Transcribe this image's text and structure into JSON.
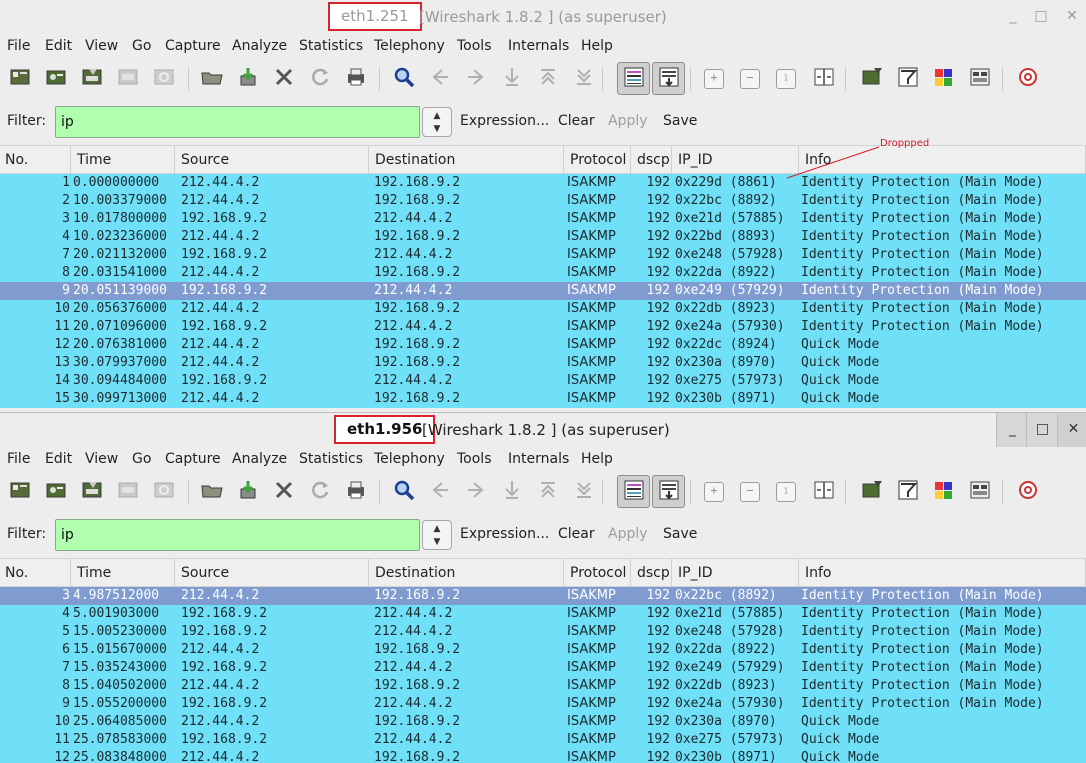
{
  "windows": [
    {
      "title": "eth1.251",
      "app_title": "[Wireshark 1.8.2 ] (as superuser)",
      "window_controls": {
        "minimize": "_",
        "maximize": "□",
        "close": "✕"
      },
      "filter": {
        "label": "Filter:",
        "value": "ip",
        "expression": "Expression...",
        "clear": "Clear",
        "apply": "Apply",
        "save": "Save"
      },
      "rows": [
        {
          "no": "1",
          "time": "0.000000000",
          "source": "212.44.4.2",
          "destination": "192.168.9.2",
          "protocol": "ISAKMP",
          "dscp": "192",
          "ip_id": "0x229d (8861)",
          "info": "Identity Protection (Main Mode)"
        },
        {
          "no": "2",
          "time": "10.003379000",
          "source": "212.44.4.2",
          "destination": "192.168.9.2",
          "protocol": "ISAKMP",
          "dscp": "192",
          "ip_id": "0x22bc (8892)",
          "info": "Identity Protection (Main Mode)"
        },
        {
          "no": "3",
          "time": "10.017800000",
          "source": "192.168.9.2",
          "destination": "212.44.4.2",
          "protocol": "ISAKMP",
          "dscp": "192",
          "ip_id": "0xe21d (57885)",
          "info": "Identity Protection (Main Mode)"
        },
        {
          "no": "4",
          "time": "10.023236000",
          "source": "212.44.4.2",
          "destination": "192.168.9.2",
          "protocol": "ISAKMP",
          "dscp": "192",
          "ip_id": "0x22bd (8893)",
          "info": "Identity Protection (Main Mode)"
        },
        {
          "no": "7",
          "time": "20.021132000",
          "source": "192.168.9.2",
          "destination": "212.44.4.2",
          "protocol": "ISAKMP",
          "dscp": "192",
          "ip_id": "0xe248 (57928)",
          "info": "Identity Protection (Main Mode)"
        },
        {
          "no": "8",
          "time": "20.031541000",
          "source": "212.44.4.2",
          "destination": "192.168.9.2",
          "protocol": "ISAKMP",
          "dscp": "192",
          "ip_id": "0x22da (8922)",
          "info": "Identity Protection (Main Mode)"
        },
        {
          "no": "9",
          "time": "20.051139000",
          "source": "192.168.9.2",
          "destination": "212.44.4.2",
          "protocol": "ISAKMP",
          "dscp": "192",
          "ip_id": "0xe249 (57929)",
          "info": "Identity Protection (Main Mode)",
          "selected": true
        },
        {
          "no": "10",
          "time": "20.056376000",
          "source": "212.44.4.2",
          "destination": "192.168.9.2",
          "protocol": "ISAKMP",
          "dscp": "192",
          "ip_id": "0x22db (8923)",
          "info": "Identity Protection (Main Mode)"
        },
        {
          "no": "11",
          "time": "20.071096000",
          "source": "192.168.9.2",
          "destination": "212.44.4.2",
          "protocol": "ISAKMP",
          "dscp": "192",
          "ip_id": "0xe24a (57930)",
          "info": "Identity Protection (Main Mode)"
        },
        {
          "no": "12",
          "time": "20.076381000",
          "source": "212.44.4.2",
          "destination": "192.168.9.2",
          "protocol": "ISAKMP",
          "dscp": "192",
          "ip_id": "0x22dc (8924)",
          "info": "Quick Mode"
        },
        {
          "no": "13",
          "time": "30.079937000",
          "source": "212.44.4.2",
          "destination": "192.168.9.2",
          "protocol": "ISAKMP",
          "dscp": "192",
          "ip_id": "0x230a (8970)",
          "info": "Quick Mode"
        },
        {
          "no": "14",
          "time": "30.094484000",
          "source": "192.168.9.2",
          "destination": "212.44.4.2",
          "protocol": "ISAKMP",
          "dscp": "192",
          "ip_id": "0xe275 (57973)",
          "info": "Quick Mode"
        },
        {
          "no": "15",
          "time": "30.099713000",
          "source": "212.44.4.2",
          "destination": "192.168.9.2",
          "protocol": "ISAKMP",
          "dscp": "192",
          "ip_id": "0x230b (8971)",
          "info": "Quick Mode"
        }
      ]
    },
    {
      "title": "eth1.956",
      "app_title": "[Wireshark 1.8.2 ] (as superuser)",
      "window_controls": {
        "minimize": "_",
        "maximize": "□",
        "close": "✕"
      },
      "filter": {
        "label": "Filter:",
        "value": "ip",
        "expression": "Expression...",
        "clear": "Clear",
        "apply": "Apply",
        "save": "Save"
      },
      "rows": [
        {
          "no": "3",
          "time": "4.987512000",
          "source": "212.44.4.2",
          "destination": "192.168.9.2",
          "protocol": "ISAKMP",
          "dscp": "192",
          "ip_id": "0x22bc (8892)",
          "info": "Identity Protection (Main Mode)",
          "selected": true
        },
        {
          "no": "4",
          "time": "5.001903000",
          "source": "192.168.9.2",
          "destination": "212.44.4.2",
          "protocol": "ISAKMP",
          "dscp": "192",
          "ip_id": "0xe21d (57885)",
          "info": "Identity Protection (Main Mode)"
        },
        {
          "no": "5",
          "time": "15.005230000",
          "source": "192.168.9.2",
          "destination": "212.44.4.2",
          "protocol": "ISAKMP",
          "dscp": "192",
          "ip_id": "0xe248 (57928)",
          "info": "Identity Protection (Main Mode)"
        },
        {
          "no": "6",
          "time": "15.015670000",
          "source": "212.44.4.2",
          "destination": "192.168.9.2",
          "protocol": "ISAKMP",
          "dscp": "192",
          "ip_id": "0x22da (8922)",
          "info": "Identity Protection (Main Mode)"
        },
        {
          "no": "7",
          "time": "15.035243000",
          "source": "192.168.9.2",
          "destination": "212.44.4.2",
          "protocol": "ISAKMP",
          "dscp": "192",
          "ip_id": "0xe249 (57929)",
          "info": "Identity Protection (Main Mode)"
        },
        {
          "no": "8",
          "time": "15.040502000",
          "source": "212.44.4.2",
          "destination": "192.168.9.2",
          "protocol": "ISAKMP",
          "dscp": "192",
          "ip_id": "0x22db (8923)",
          "info": "Identity Protection (Main Mode)"
        },
        {
          "no": "9",
          "time": "15.055200000",
          "source": "192.168.9.2",
          "destination": "212.44.4.2",
          "protocol": "ISAKMP",
          "dscp": "192",
          "ip_id": "0xe24a (57930)",
          "info": "Identity Protection (Main Mode)"
        },
        {
          "no": "10",
          "time": "25.064085000",
          "source": "212.44.4.2",
          "destination": "192.168.9.2",
          "protocol": "ISAKMP",
          "dscp": "192",
          "ip_id": "0x230a (8970)",
          "info": "Quick Mode"
        },
        {
          "no": "11",
          "time": "25.078583000",
          "source": "192.168.9.2",
          "destination": "212.44.4.2",
          "protocol": "ISAKMP",
          "dscp": "192",
          "ip_id": "0xe275 (57973)",
          "info": "Quick Mode"
        },
        {
          "no": "12",
          "time": "25.083848000",
          "source": "212.44.4.2",
          "destination": "192.168.9.2",
          "protocol": "ISAKMP",
          "dscp": "192",
          "ip_id": "0x230b (8971)",
          "info": "Quick Mode"
        }
      ]
    }
  ],
  "menu": [
    "File",
    "Edit",
    "View",
    "Go",
    "Capture",
    "Analyze",
    "Statistics",
    "Telephony",
    "Tools",
    "Internals",
    "Help"
  ],
  "columns": [
    "No.",
    "Time",
    "Source",
    "Destination",
    "Protocol",
    "dscp",
    "IP_ID",
    "Info"
  ],
  "toolbar_icons": [
    "interface-list-icon",
    "capture-options-icon",
    "start-capture-icon",
    "stop-capture-icon",
    "restart-capture-icon",
    "open-file-icon",
    "save-file-icon",
    "close-file-icon",
    "reload-icon",
    "print-icon",
    "find-packet-icon",
    "go-back-icon",
    "go-forward-icon",
    "go-to-packet-icon",
    "go-first-icon",
    "go-last-icon",
    "colorize-icon",
    "auto-scroll-icon",
    "zoom-in-icon",
    "zoom-out-icon",
    "normal-size-icon",
    "resize-columns-icon",
    "capture-filters-icon",
    "display-filters-icon",
    "coloring-rules-icon",
    "preferences-icon",
    "help-icon"
  ],
  "annotation": {
    "text": "Droppped",
    "color": "#cf1f2a"
  },
  "colors": {
    "row_bg": "#70e0f8",
    "selected_row_bg": "#7f9bcf",
    "filter_bg": "#afffaf",
    "title_box_border": "#d9232e"
  }
}
